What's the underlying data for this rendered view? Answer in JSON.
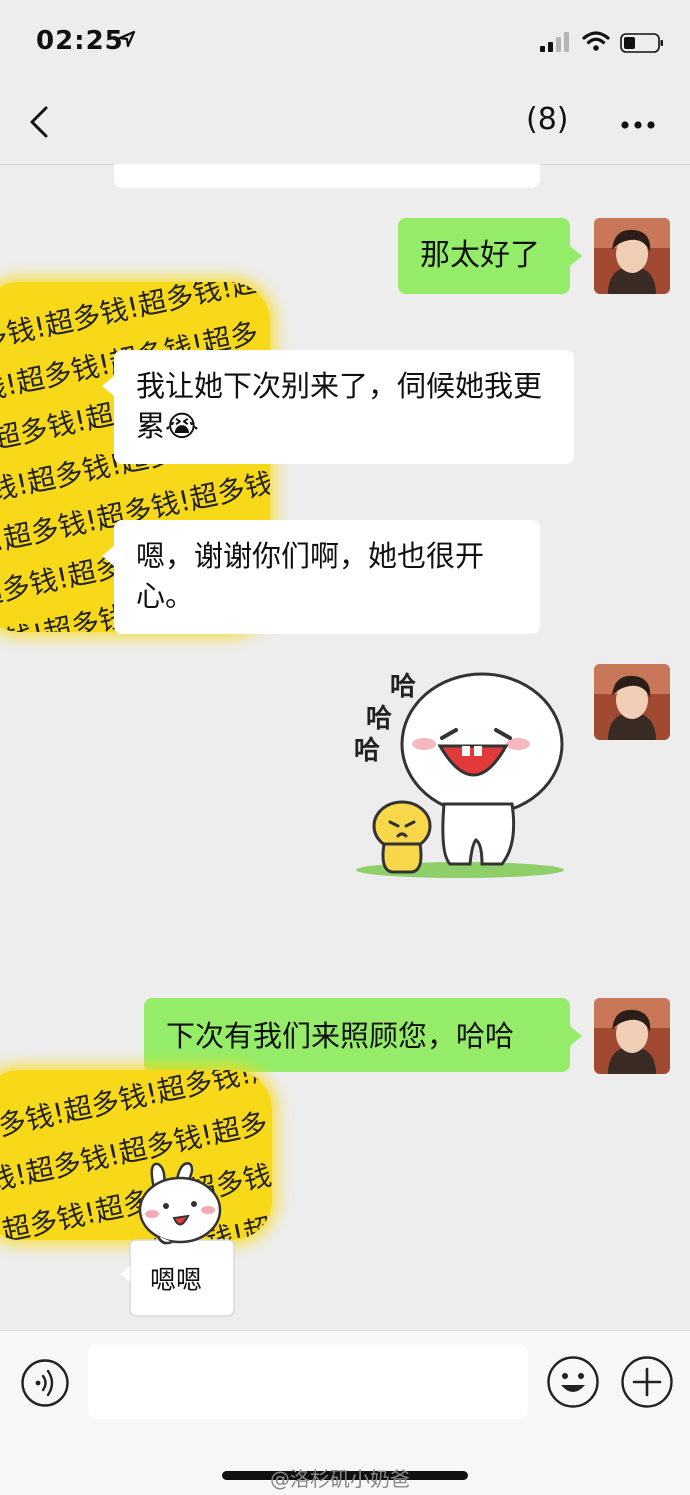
{
  "status_bar": {
    "time": "02:25"
  },
  "nav": {
    "member_count": "(8)"
  },
  "messages": [
    {
      "from": "me",
      "text": "那太好了"
    },
    {
      "from": "other",
      "text": "我让她下次别来了，伺候她我更累😭"
    },
    {
      "from": "other",
      "text": "嗯，谢谢你们啊，她也很开心。"
    },
    {
      "from": "me",
      "sticker": "haha-sticker",
      "sticker_text": [
        "哈",
        "哈",
        "哈"
      ]
    },
    {
      "from": "me",
      "text": "下次有我们来照顾您，哈哈"
    },
    {
      "from": "other",
      "sticker": "bunny-sticker",
      "sticker_text": "嗯嗯"
    }
  ],
  "censor_text": "钱!超多钱!超多钱!超多钱!超多",
  "watermark": "@洛杉矶小奶爸",
  "colors": {
    "bubble_me": "#95ec69",
    "bubble_other": "#ffffff",
    "background": "#ededed",
    "censor": "#f7d91a"
  }
}
